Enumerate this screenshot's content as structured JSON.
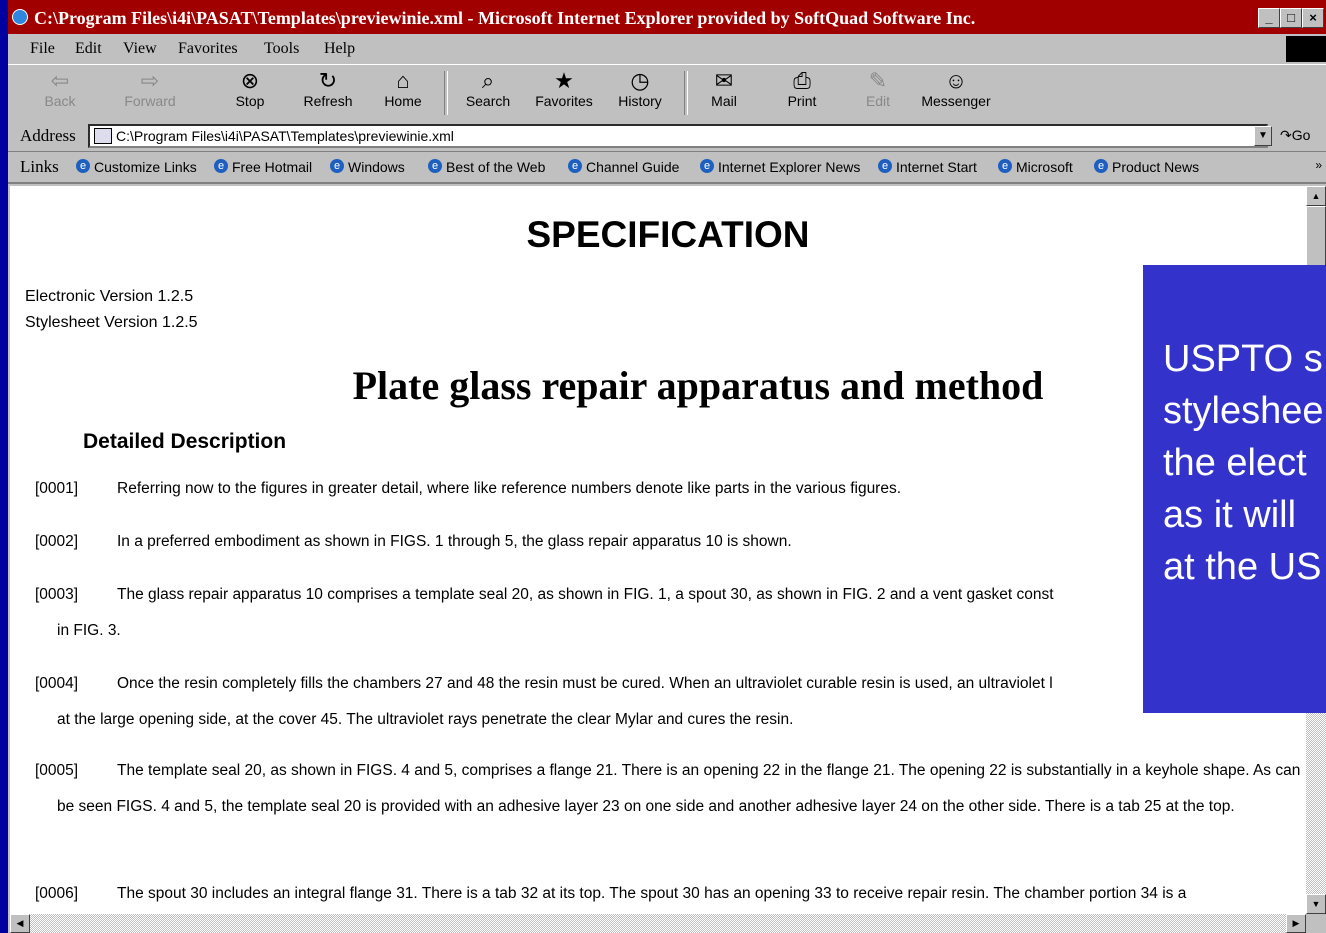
{
  "window": {
    "title": "C:\\Program Files\\i4i\\PASAT\\Templates\\previewinie.xml - Microsoft Internet Explorer provided by SoftQuad Software Inc.",
    "controls": [
      "_",
      "□",
      "×"
    ]
  },
  "menu": [
    "File",
    "Edit",
    "View",
    "Favorites",
    "Tools",
    "Help"
  ],
  "toolbar": [
    {
      "label": "Back",
      "icon": "back-arrow-icon",
      "glyph": "⇦",
      "enabled": false
    },
    {
      "label": "Forward",
      "icon": "forward-arrow-icon",
      "glyph": "⇨",
      "enabled": false
    },
    {
      "label": "Stop",
      "icon": "stop-icon",
      "glyph": "⊗",
      "enabled": true
    },
    {
      "label": "Refresh",
      "icon": "refresh-icon",
      "glyph": "↻",
      "enabled": true
    },
    {
      "label": "Home",
      "icon": "home-icon",
      "glyph": "⌂",
      "enabled": true
    },
    {
      "label": "Search",
      "icon": "search-icon",
      "glyph": "⌕",
      "enabled": true
    },
    {
      "label": "Favorites",
      "icon": "favorites-icon",
      "glyph": "★",
      "enabled": true
    },
    {
      "label": "History",
      "icon": "history-icon",
      "glyph": "◷",
      "enabled": true
    },
    {
      "label": "Mail",
      "icon": "mail-icon",
      "glyph": "✉",
      "enabled": true
    },
    {
      "label": "Print",
      "icon": "print-icon",
      "glyph": "⎙",
      "enabled": true
    },
    {
      "label": "Edit",
      "icon": "edit-icon",
      "glyph": "✎",
      "enabled": false
    },
    {
      "label": "Messenger",
      "icon": "messenger-icon",
      "glyph": "☺",
      "enabled": true
    }
  ],
  "address": {
    "label": "Address",
    "value": "C:\\Program Files\\i4i\\PASAT\\Templates\\previewinie.xml",
    "go": "Go"
  },
  "links": {
    "label": "Links",
    "items": [
      "Customize Links",
      "Free Hotmail",
      "Windows",
      "Best of the Web",
      "Channel Guide",
      "Internet Explorer News",
      "Internet Start",
      "Microsoft",
      "Product News"
    ]
  },
  "document": {
    "heading": "SPECIFICATION",
    "electronic_version": "Electronic Version 1.2.5",
    "stylesheet_version": "Stylesheet Version 1.2.5",
    "title": "Plate glass repair apparatus and method",
    "section": "Detailed Description",
    "paragraphs": [
      {
        "num": "[0001]",
        "text": "Referring now to the figures in greater detail, where like reference numbers denote like parts in the various figures."
      },
      {
        "num": "[0002]",
        "text": "In a preferred embodiment as shown in FIGS. 1 through 5, the glass repair apparatus 10 is shown."
      },
      {
        "num": "[0003]",
        "text": "The glass repair apparatus 10 comprises a template seal 20, as shown in FIG. 1, a spout 30, as shown in FIG. 2 and a vent gasket const"
      },
      {
        "num": "[0004]",
        "text": "Once the resin completely fills the chambers 27 and 48 the resin must be cured. When an ultraviolet curable resin is used, an ultraviolet l"
      },
      {
        "num": "[0005]",
        "text": "The template seal 20, as shown in FIGS. 4 and 5, comprises a flange 21. There is an opening 22 in the flange 21. The opening 22 is substantially in a keyhole shape. As can be seen FIGS. 4 and 5, the template seal 20 is provided with an adhesive layer 23 on one side and another adhesive layer 24 on the other side. There is a tab 25 at the top."
      },
      {
        "num": "[0006]",
        "text": "The spout 30 includes an integral flange 31. There is a tab 32 at its top. The spout 30 has an opening 33 to receive repair resin. The chamber portion 34 is a"
      }
    ],
    "p3_cont": "in FIG. 3.",
    "p4_cont": "at the large opening side, at the cover 45. The ultraviolet rays penetrate the clear Mylar and cures the resin."
  },
  "overlay": {
    "lines": [
      "USPTO s",
      "styleshee",
      "the elect",
      "as it will",
      "at the US"
    ],
    "color": "#3333cc"
  }
}
